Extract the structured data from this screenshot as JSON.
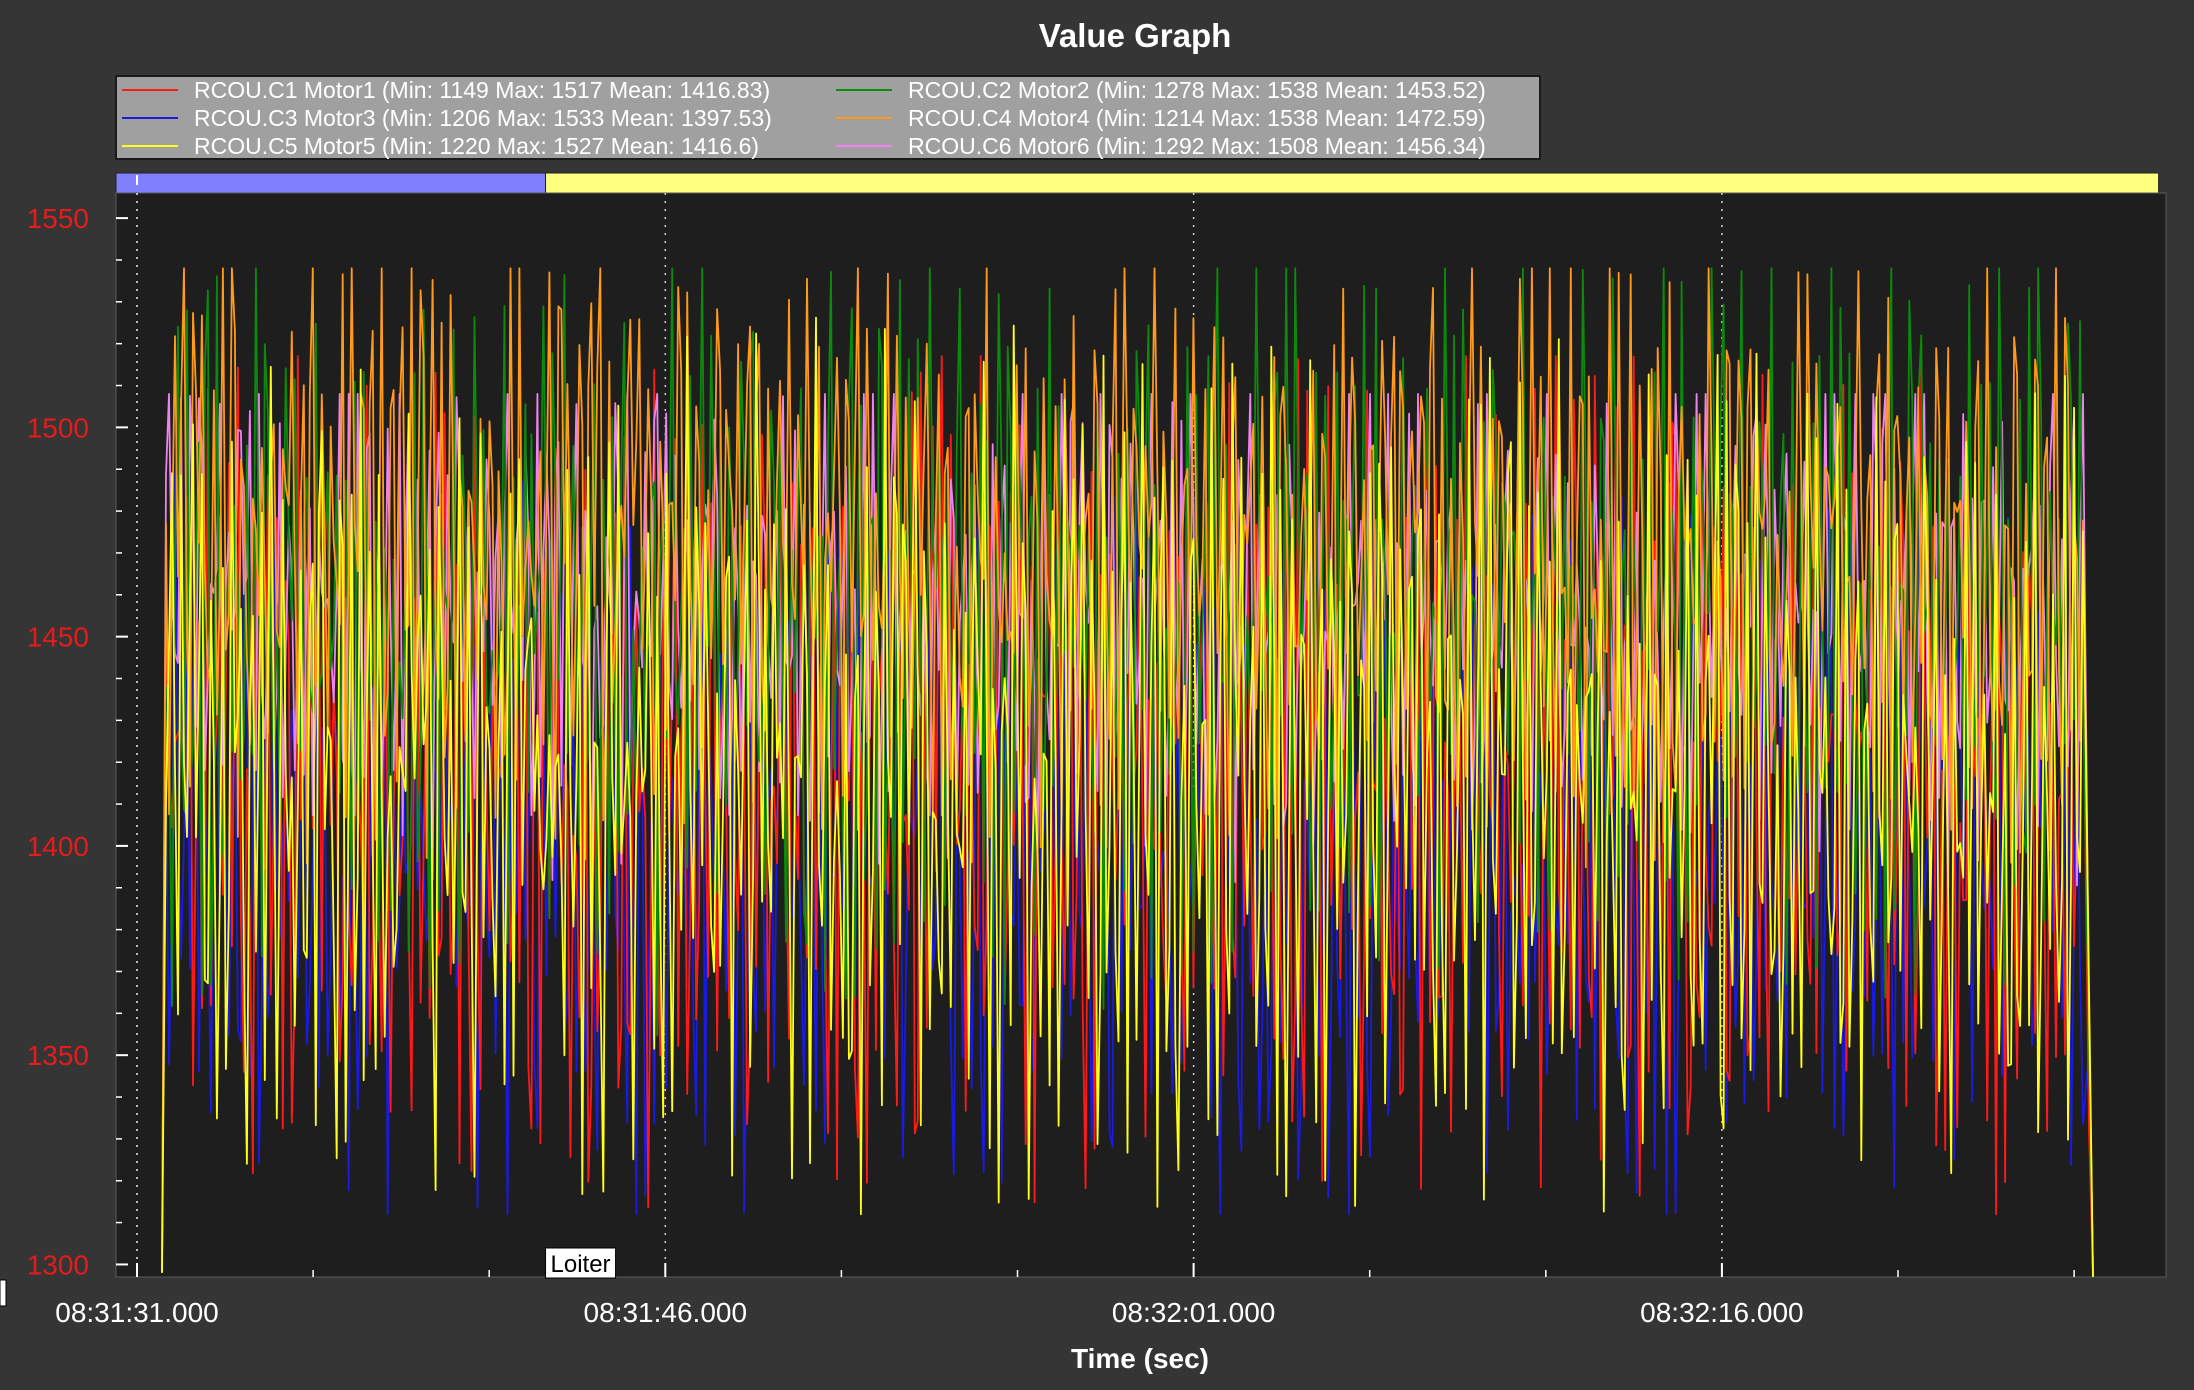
{
  "chart_data": {
    "type": "line",
    "title": "Value Graph",
    "xlabel": "Time (sec)",
    "ylabel": "",
    "ylim": [
      1297,
      1556
    ],
    "xlim_seconds_span": 38.0,
    "grid": true,
    "legend_position": "top-left",
    "y_ticks": [
      "1550",
      "1500",
      "1450",
      "1400",
      "1350",
      "1300"
    ],
    "x_ticks": [
      "08:31:31.000",
      "08:31:46.000",
      "08:32:01.000",
      "08:32:16.000"
    ],
    "mode_segments": [
      {
        "label": "",
        "color": "#8080ff",
        "start_time": "08:31:30.400",
        "end_time": "08:31:42.600"
      },
      {
        "label": "Loiter",
        "color": "#ffff80",
        "start_time": "08:31:42.600",
        "end_time": "08:32:28.400"
      }
    ],
    "series": [
      {
        "name": "RCOU.C1 Motor1",
        "color": "#ff1a1a",
        "stats": "(Min: 1149 Max: 1517 Mean: 1416.83)",
        "min": 1149,
        "max": 1517,
        "mean": 1416.83
      },
      {
        "name": "RCOU.C2 Motor2",
        "color": "#0b8a0b",
        "stats": "(Min: 1278 Max: 1538 Mean: 1453.52)",
        "min": 1278,
        "max": 1538,
        "mean": 1453.52
      },
      {
        "name": "RCOU.C3 Motor3",
        "color": "#1a1ae0",
        "stats": "(Min: 1206 Max: 1533 Mean: 1397.53)",
        "min": 1206,
        "max": 1533,
        "mean": 1397.53
      },
      {
        "name": "RCOU.C4 Motor4",
        "color": "#ff9a1a",
        "stats": "(Min: 1214 Max: 1538 Mean: 1472.59)",
        "min": 1214,
        "max": 1538,
        "mean": 1472.59
      },
      {
        "name": "RCOU.C5 Motor5",
        "color": "#ffff1a",
        "stats": "(Min: 1220 Max: 1527 Mean: 1416.6)",
        "min": 1220,
        "max": 1527,
        "mean": 1416.6
      },
      {
        "name": "RCOU.C6 Motor6",
        "color": "#ee82ee",
        "stats": "(Min: 1292 Max: 1508 Mean: 1456.34)",
        "min": 1292,
        "max": 1508,
        "mean": 1456.34
      }
    ]
  }
}
